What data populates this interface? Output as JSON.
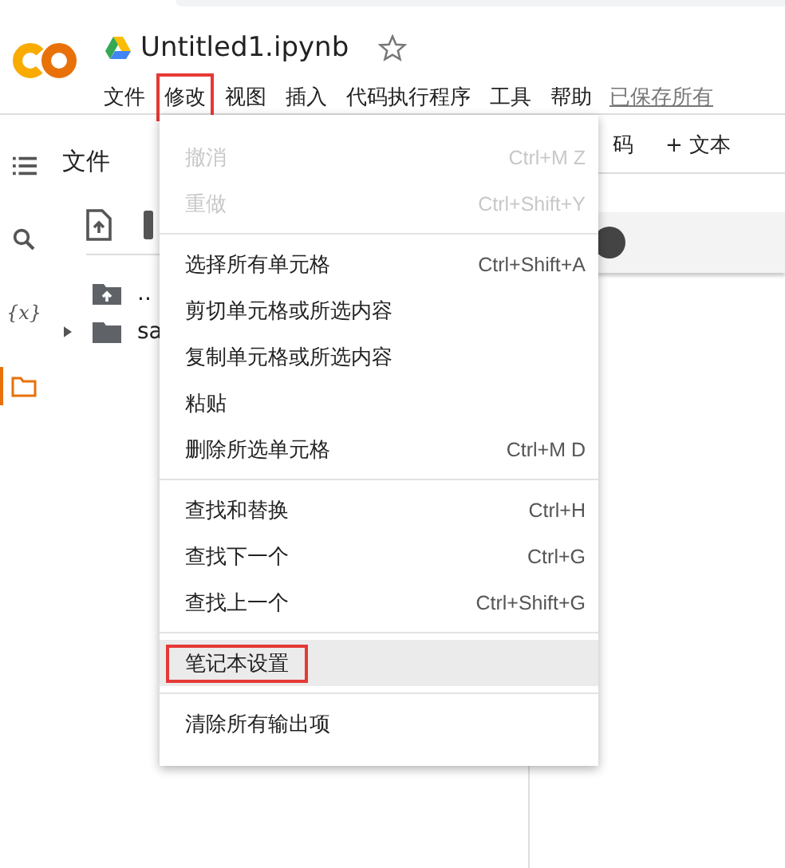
{
  "header": {
    "title": "Untitled1.ipynb",
    "menus": [
      {
        "label": "文件",
        "outlined": false
      },
      {
        "label": "修改",
        "outlined": true
      },
      {
        "label": "视图",
        "outlined": false
      },
      {
        "label": "插入",
        "outlined": false
      },
      {
        "label": "代码执行程序",
        "outlined": false
      },
      {
        "label": "工具",
        "outlined": false
      },
      {
        "label": "帮助",
        "outlined": false
      }
    ],
    "save_status": "已保存所有"
  },
  "rail": [
    {
      "kind": "list",
      "selected": false
    },
    {
      "kind": "search",
      "selected": false
    },
    {
      "kind": "variables",
      "label": "{x}",
      "selected": false
    },
    {
      "kind": "folder",
      "selected": true
    }
  ],
  "files_panel": {
    "title": "文件",
    "tree": [
      {
        "name": "..",
        "kind": "up",
        "expandable": false
      },
      {
        "name": "sa",
        "kind": "folder",
        "expandable": true
      }
    ]
  },
  "notebook": {
    "toolbar": [
      "码",
      "+ 文本"
    ]
  },
  "dropdown": {
    "groups": [
      [
        {
          "label": "撤消",
          "shortcut": "Ctrl+M Z",
          "disabled": true,
          "hovered": false,
          "outlined": false
        },
        {
          "label": "重做",
          "shortcut": "Ctrl+Shift+Y",
          "disabled": true,
          "hovered": false,
          "outlined": false
        }
      ],
      [
        {
          "label": "选择所有单元格",
          "shortcut": "Ctrl+Shift+A",
          "disabled": false,
          "hovered": false,
          "outlined": false
        },
        {
          "label": "剪切单元格或所选内容",
          "disabled": false,
          "hovered": false,
          "outlined": false
        },
        {
          "label": "复制单元格或所选内容",
          "disabled": false,
          "hovered": false,
          "outlined": false
        },
        {
          "label": "粘贴",
          "disabled": false,
          "hovered": false,
          "outlined": false
        },
        {
          "label": "删除所选单元格",
          "shortcut": "Ctrl+M D",
          "disabled": false,
          "hovered": false,
          "outlined": false
        }
      ],
      [
        {
          "label": "查找和替换",
          "shortcut": "Ctrl+H",
          "disabled": false,
          "hovered": false,
          "outlined": false
        },
        {
          "label": "查找下一个",
          "shortcut": "Ctrl+G",
          "disabled": false,
          "hovered": false,
          "outlined": false
        },
        {
          "label": "查找上一个",
          "shortcut": "Ctrl+Shift+G",
          "disabled": false,
          "hovered": false,
          "outlined": false
        }
      ],
      [
        {
          "label": "笔记本设置",
          "disabled": false,
          "hovered": true,
          "outlined": true
        }
      ],
      [
        {
          "label": "清除所有输出项",
          "disabled": false,
          "hovered": false,
          "outlined": false
        }
      ]
    ]
  }
}
